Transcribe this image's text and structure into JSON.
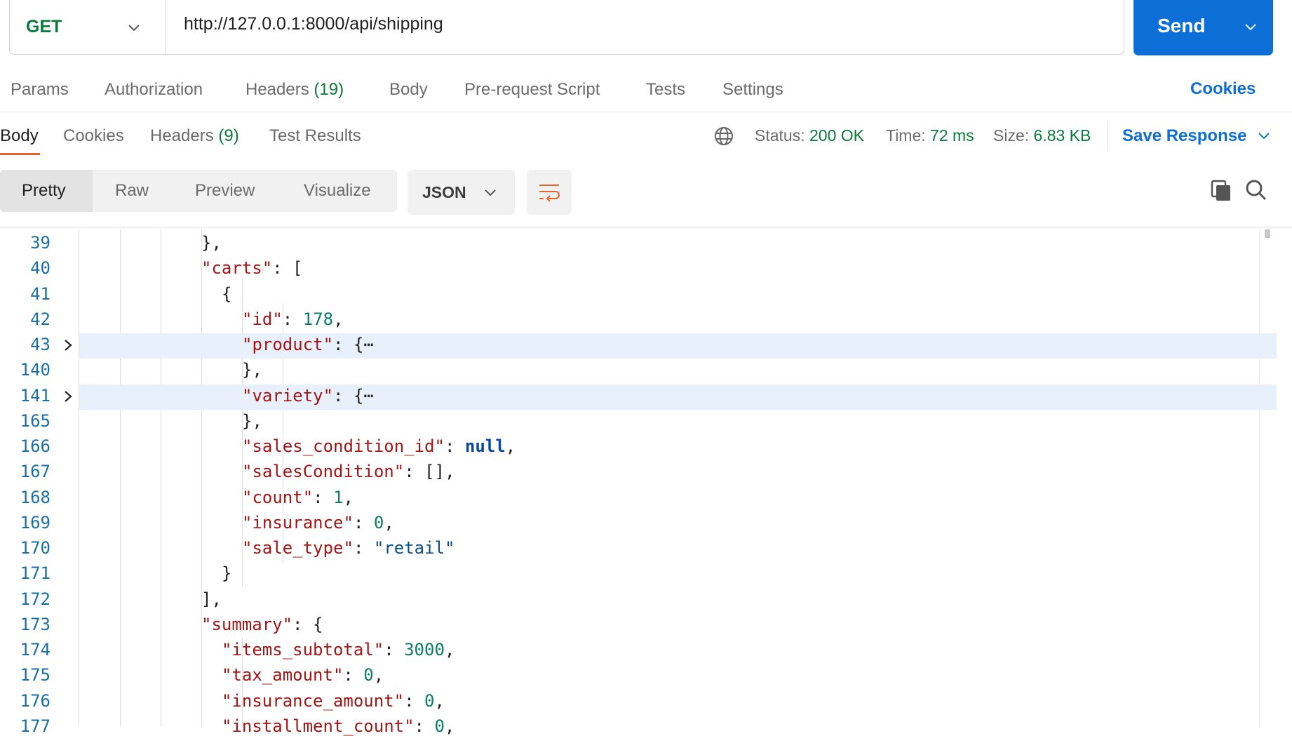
{
  "request": {
    "method": "GET",
    "url": "http://127.0.0.1:8000/api/shipping",
    "send_label": "Send"
  },
  "request_tabs": {
    "params": "Params",
    "authorization": "Authorization",
    "headers": "Headers",
    "headers_count": "(19)",
    "body": "Body",
    "pre_request": "Pre-request Script",
    "tests": "Tests",
    "settings": "Settings",
    "cookies": "Cookies"
  },
  "response_tabs": {
    "body": "Body",
    "cookies": "Cookies",
    "headers": "Headers",
    "headers_count": "(9)",
    "test_results": "Test Results"
  },
  "response_meta": {
    "status_label": "Status:",
    "status_value": "200 OK",
    "time_label": "Time:",
    "time_value": "72 ms",
    "size_label": "Size:",
    "size_value": "6.83 KB",
    "save_response": "Save Response"
  },
  "view_toolbar": {
    "pretty": "Pretty",
    "raw": "Raw",
    "preview": "Preview",
    "visualize": "Visualize",
    "format": "JSON"
  },
  "icons": {
    "method_dropdown": "chevron-down-icon",
    "send_dropdown": "chevron-down-icon",
    "globe": "globe-icon",
    "save_dropdown": "chevron-down-icon",
    "format_dropdown": "chevron-down-icon",
    "wrap": "wrap-lines-icon",
    "copy": "copy-icon",
    "search": "search-icon",
    "fold": "chevron-right-icon"
  },
  "colors": {
    "accent_blue": "#0c6fd8",
    "status_green": "#0a7a3b",
    "active_tab_underline": "#e8622b",
    "json_key": "#a31515",
    "json_string": "#0b4f8c",
    "json_number": "#0a7d63",
    "json_null": "#0b47a8",
    "line_number": "#1a6fa6",
    "fold_highlight": "#e8f0fb"
  },
  "code_lines": [
    {
      "n": "39",
      "tokens": [
        {
          "t": "p",
          "v": "},"
        }
      ]
    },
    {
      "n": "40",
      "tokens": [
        {
          "t": "k",
          "v": "\"carts\""
        },
        {
          "t": "p",
          "v": ": ["
        }
      ]
    },
    {
      "n": "41",
      "tokens": [
        {
          "t": "p",
          "v": "{"
        }
      ]
    },
    {
      "n": "42",
      "tokens": [
        {
          "t": "k",
          "v": "\"id\""
        },
        {
          "t": "p",
          "v": ": "
        },
        {
          "t": "n",
          "v": "178"
        },
        {
          "t": "p",
          "v": ","
        }
      ]
    },
    {
      "n": "43",
      "fold": true,
      "tokens": [
        {
          "t": "k",
          "v": "\"product\""
        },
        {
          "t": "p",
          "v": ": {⋯"
        }
      ]
    },
    {
      "n": "140",
      "tokens": [
        {
          "t": "p",
          "v": "},"
        }
      ]
    },
    {
      "n": "141",
      "fold": true,
      "tokens": [
        {
          "t": "k",
          "v": "\"variety\""
        },
        {
          "t": "p",
          "v": ": {⋯"
        }
      ]
    },
    {
      "n": "165",
      "tokens": [
        {
          "t": "p",
          "v": "},"
        }
      ]
    },
    {
      "n": "166",
      "tokens": [
        {
          "t": "k",
          "v": "\"sales_condition_id\""
        },
        {
          "t": "p",
          "v": ": "
        },
        {
          "t": "nl",
          "v": "null"
        },
        {
          "t": "p",
          "v": ","
        }
      ]
    },
    {
      "n": "167",
      "tokens": [
        {
          "t": "k",
          "v": "\"salesCondition\""
        },
        {
          "t": "p",
          "v": ": [],"
        }
      ]
    },
    {
      "n": "168",
      "tokens": [
        {
          "t": "k",
          "v": "\"count\""
        },
        {
          "t": "p",
          "v": ": "
        },
        {
          "t": "n",
          "v": "1"
        },
        {
          "t": "p",
          "v": ","
        }
      ]
    },
    {
      "n": "169",
      "tokens": [
        {
          "t": "k",
          "v": "\"insurance\""
        },
        {
          "t": "p",
          "v": ": "
        },
        {
          "t": "n",
          "v": "0"
        },
        {
          "t": "p",
          "v": ","
        }
      ]
    },
    {
      "n": "170",
      "tokens": [
        {
          "t": "k",
          "v": "\"sale_type\""
        },
        {
          "t": "p",
          "v": ": "
        },
        {
          "t": "s",
          "v": "\"retail\""
        }
      ]
    },
    {
      "n": "171",
      "tokens": [
        {
          "t": "p",
          "v": "}"
        }
      ]
    },
    {
      "n": "172",
      "tokens": [
        {
          "t": "p",
          "v": "],"
        }
      ]
    },
    {
      "n": "173",
      "tokens": [
        {
          "t": "k",
          "v": "\"summary\""
        },
        {
          "t": "p",
          "v": ": {"
        }
      ]
    },
    {
      "n": "174",
      "tokens": [
        {
          "t": "k",
          "v": "\"items_subtotal\""
        },
        {
          "t": "p",
          "v": ": "
        },
        {
          "t": "n",
          "v": "3000"
        },
        {
          "t": "p",
          "v": ","
        }
      ]
    },
    {
      "n": "175",
      "tokens": [
        {
          "t": "k",
          "v": "\"tax_amount\""
        },
        {
          "t": "p",
          "v": ": "
        },
        {
          "t": "n",
          "v": "0"
        },
        {
          "t": "p",
          "v": ","
        }
      ]
    },
    {
      "n": "176",
      "tokens": [
        {
          "t": "k",
          "v": "\"insurance_amount\""
        },
        {
          "t": "p",
          "v": ": "
        },
        {
          "t": "n",
          "v": "0"
        },
        {
          "t": "p",
          "v": ","
        }
      ]
    },
    {
      "n": "177",
      "tokens": [
        {
          "t": "k",
          "v": "\"installment_count\""
        },
        {
          "t": "p",
          "v": ": "
        },
        {
          "t": "n",
          "v": "0"
        },
        {
          "t": "p",
          "v": ","
        }
      ]
    }
  ]
}
